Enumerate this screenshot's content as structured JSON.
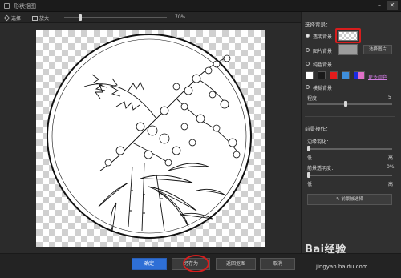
{
  "window": {
    "title": "形状抠图",
    "minimize_icon": "minimize-icon",
    "close_icon": "close-icon"
  },
  "toolbar": {
    "select_label": "选择",
    "zoom_label": "放大",
    "zoom_value": "70%"
  },
  "panel": {
    "bg_section_title": "选择背景：",
    "transparent_label": "透明背景",
    "image_label": "图片背景",
    "select_image_btn": "选择图片",
    "solid_label": "纯色背景",
    "colors": [
      "#ffffff",
      "#1a1a1a",
      "#e41c1c",
      "#3f8fdc",
      "#1b2be0",
      "#e070c8"
    ],
    "more_colors_label": "更多颜色",
    "blur_label": "模糊背景",
    "blur_amount_label": "程度",
    "blur_amount_value": "5",
    "fg_section_title": "前景操作：",
    "edge_label": "边缘羽化：",
    "edge_low": "低",
    "edge_high": "高",
    "opacity_label": "前景透明度：",
    "opacity_value": "0%",
    "opacity_low": "低",
    "opacity_high": "高",
    "fg_more_btn": "前景被选择"
  },
  "bottom": {
    "confirm_btn": "确定",
    "save_as_btn": "另存为",
    "back_btn": "返回抠图",
    "cancel_btn": "取消"
  },
  "watermark": {
    "brand": "Bai经验",
    "url": "jingyan.baidu.com"
  }
}
